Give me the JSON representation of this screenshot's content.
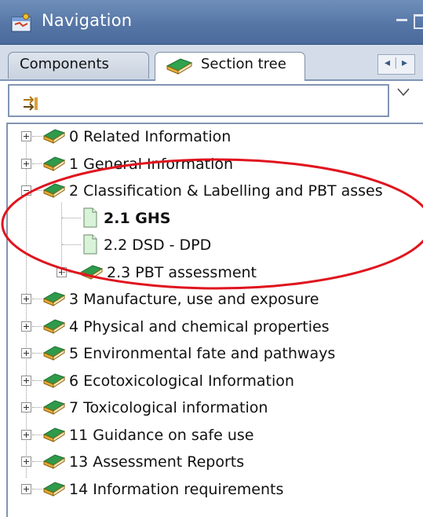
{
  "titlebar": {
    "title": "Navigation",
    "icon": "navigation-icon"
  },
  "tabs": [
    {
      "label": "Components",
      "active": false
    },
    {
      "label": "Section tree",
      "active": true,
      "icon": "book-icon"
    }
  ],
  "tree": [
    {
      "label": "0 Related Information",
      "expander": "plus",
      "icon": "book-icon",
      "bold": false
    },
    {
      "label": "1 General Information",
      "expander": "plus",
      "icon": "book-icon",
      "bold": false
    },
    {
      "label": "2 Classification & Labelling and PBT asses",
      "expander": "minus",
      "icon": "book-icon",
      "bold": false
    },
    {
      "label": "2.1 GHS",
      "expander": "none",
      "icon": "page-icon",
      "bold": true
    },
    {
      "label": "2.2 DSD - DPD",
      "expander": "none",
      "icon": "page-icon",
      "bold": false
    },
    {
      "label": "2.3 PBT assessment",
      "expander": "plus",
      "icon": "book-icon",
      "bold": false
    },
    {
      "label": "3 Manufacture, use and exposure",
      "expander": "plus",
      "icon": "book-icon",
      "bold": false
    },
    {
      "label": "4 Physical and chemical properties",
      "expander": "plus",
      "icon": "book-icon",
      "bold": false
    },
    {
      "label": "5 Environmental fate and pathways",
      "expander": "plus",
      "icon": "book-icon",
      "bold": false
    },
    {
      "label": "6 Ecotoxicological Information",
      "expander": "plus",
      "icon": "book-icon",
      "bold": false
    },
    {
      "label": "7 Toxicological information",
      "expander": "plus",
      "icon": "book-icon",
      "bold": false
    },
    {
      "label": "11 Guidance on safe use",
      "expander": "plus",
      "icon": "book-icon",
      "bold": false
    },
    {
      "label": "13 Assessment Reports",
      "expander": "plus",
      "icon": "book-icon",
      "bold": false
    },
    {
      "label": "14 Information requirements",
      "expander": "plus",
      "icon": "book-icon",
      "bold": false
    }
  ],
  "colors": {
    "titlebar": "#5676a6",
    "annotation": "#e0141e",
    "book": "#2e9a4a",
    "page": "#d8f3d8"
  }
}
